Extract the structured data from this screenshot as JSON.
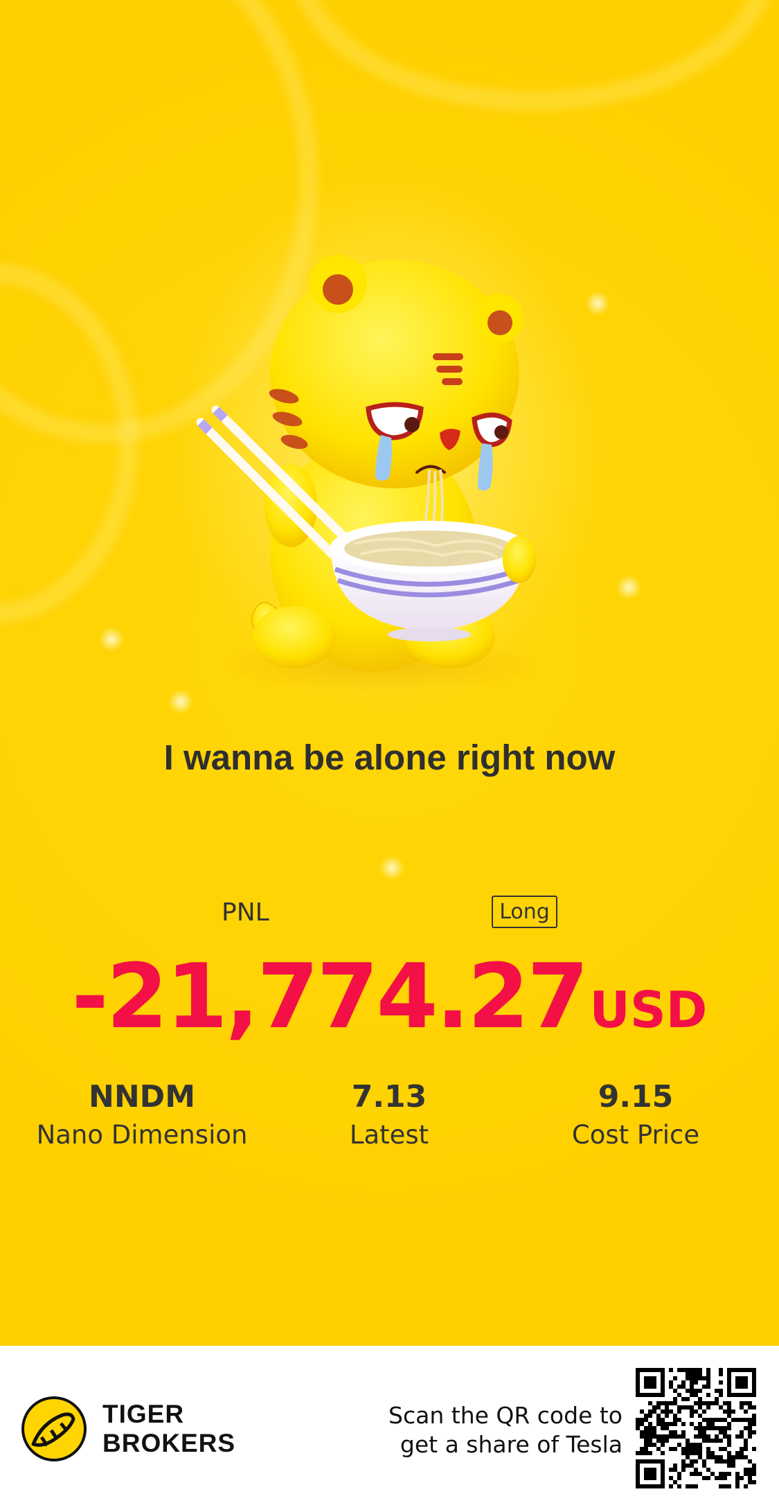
{
  "headline": "I wanna be alone right now",
  "pnl": {
    "label": "PNL",
    "side_badge": "Long",
    "amount": "-21,774.27",
    "currency": "USD"
  },
  "stats": [
    {
      "value": "NNDM",
      "label": "Nano Dimension"
    },
    {
      "value": "7.13",
      "label": "Latest"
    },
    {
      "value": "9.15",
      "label": "Cost Price"
    }
  ],
  "footer": {
    "brand_line1": "TIGER",
    "brand_line2": "BROKERS",
    "scan_line1": "Scan the QR code to",
    "scan_line2": "get a share of Tesla"
  },
  "colors": {
    "background": "#ffd400",
    "loss": "#f21046",
    "text": "#2b2b2b"
  },
  "icons": {
    "mascot": "crying-tiger-eating-noodles",
    "logo": "tiger-brokers-logo-icon",
    "qr": "qr-code-icon"
  }
}
